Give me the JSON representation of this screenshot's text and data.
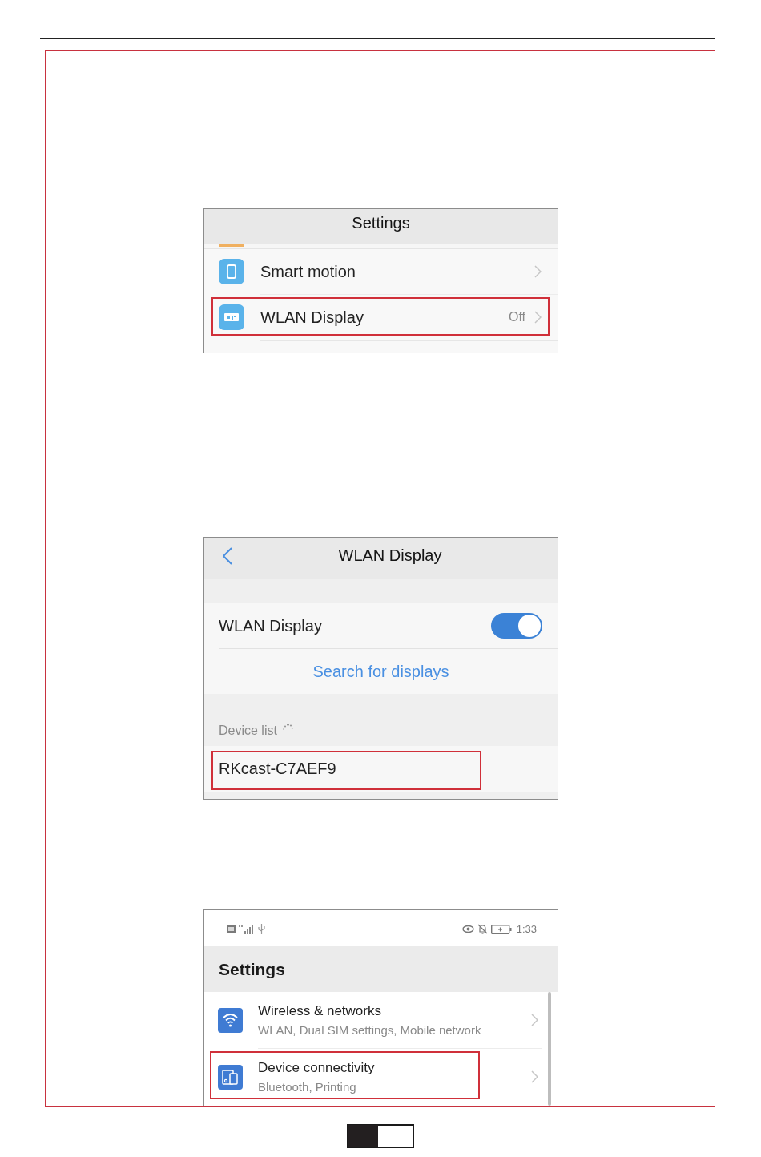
{
  "screenshots": [
    {
      "kind": "settings_list",
      "title": "Settings",
      "rows": [
        {
          "label": "Smart motion",
          "highlighted": false
        },
        {
          "label": "WLAN Display",
          "value": "Off",
          "highlighted": true
        }
      ]
    },
    {
      "kind": "wlan_display",
      "title": "WLAN Display",
      "toggle": {
        "label": "WLAN Display",
        "on": true
      },
      "action": "Search for displays",
      "section": {
        "label": "Device list",
        "scanning": true
      },
      "devices": [
        {
          "name": "RKcast-C7AEF9",
          "highlighted": true
        }
      ]
    },
    {
      "kind": "settings_home",
      "status_bar": {
        "time": "1:33"
      },
      "title": "Settings",
      "rows": [
        {
          "title": "Wireless & networks",
          "subtitle": "WLAN, Dual SIM settings, Mobile network",
          "highlighted": false
        },
        {
          "title": "Device connectivity",
          "subtitle": "Bluetooth, Printing",
          "highlighted": true
        }
      ]
    }
  ]
}
